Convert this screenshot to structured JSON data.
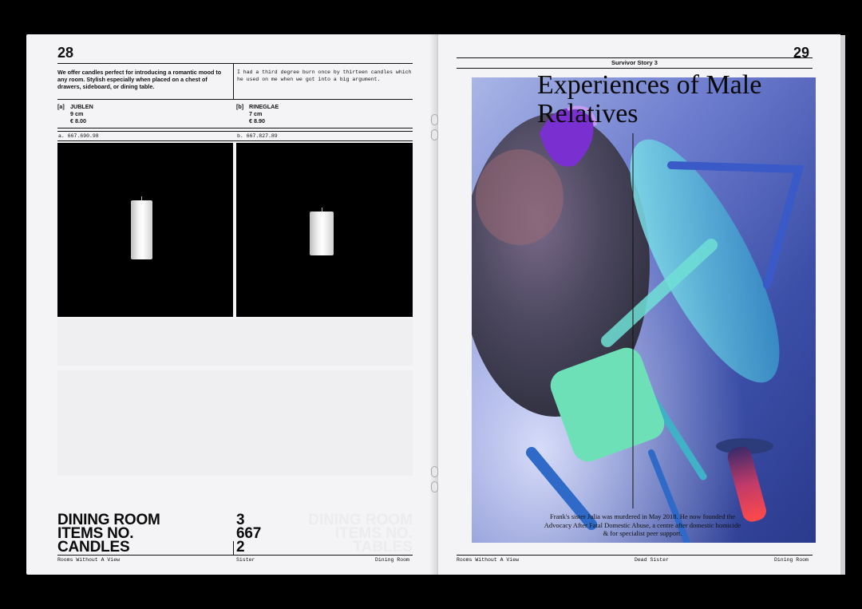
{
  "left_page": {
    "page_number": "28",
    "intro": "We offer candles perfect for introducing a romantic mood to any room. Stylish especially when placed on a chest of drawers, sideboard, or dining table.",
    "quote": "I had a third degree burn once by thirteen candles which he used on me when we got into a big argument.",
    "items": [
      {
        "tag": "[a]",
        "name": "JUBLEN",
        "size": "9 cm",
        "price": "€ 8.00",
        "code": "a. 667.690.98"
      },
      {
        "tag": "[b]",
        "name": "RINEGLAE",
        "size": "7 cm",
        "price": "€ 8.90",
        "code": "b. 667.827.89"
      }
    ],
    "summary": {
      "labels": [
        "DINING ROOM",
        "ITEMS NO.",
        "CANDLES"
      ],
      "values": [
        "3",
        "667",
        "2"
      ]
    },
    "footer": {
      "left": "Rooms Without A View",
      "center": "Sister",
      "right": "Dining Room"
    }
  },
  "right_page": {
    "page_number": "29",
    "section": "Survivor Story 3",
    "headline": "Experiences of Male Relatives",
    "caption": "Frank's sister Julia was murdered in May 2018. He now founded the Advocacy After Fatal Domestic Abuse, a centre after domestic homicide & for specialist peer support.",
    "footer": {
      "left": "Rooms Without A View",
      "center": "Dead Sister",
      "right": "Dining Room"
    }
  },
  "colors": {
    "background": "#000000",
    "paper": "#f4f4f6",
    "ink": "#111111",
    "art_blue": "#3c4fa8",
    "art_teal": "#5fd4c8",
    "art_purple": "#7a2fd0"
  }
}
